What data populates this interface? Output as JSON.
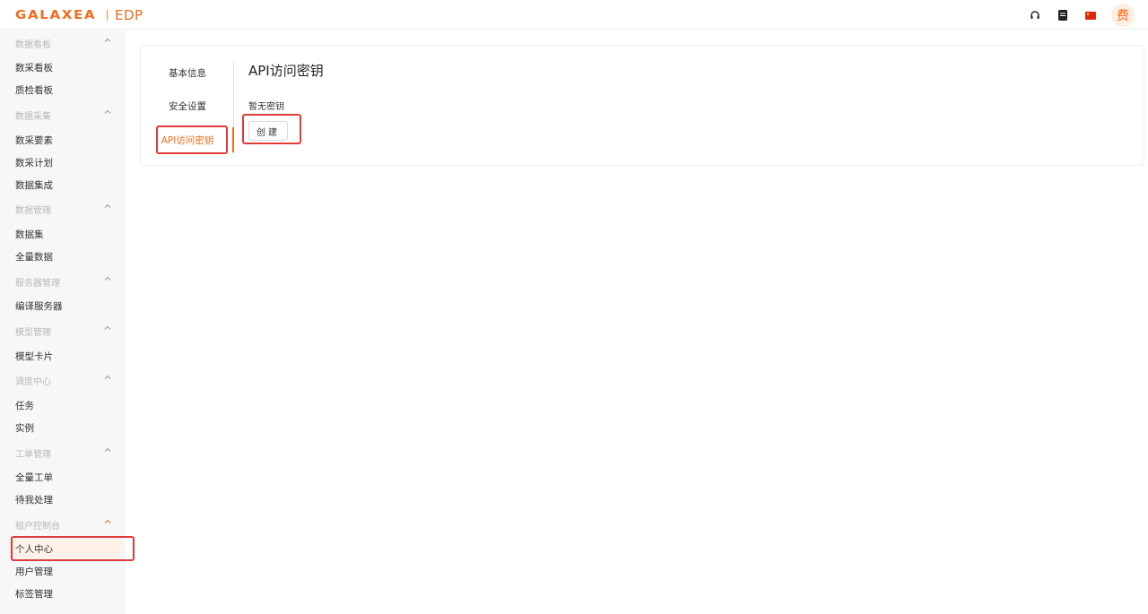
{
  "header": {
    "logo_brand": "GALAXEA",
    "logo_product": "EDP",
    "icons": [
      "headset-icon",
      "book-icon",
      "china-flag-icon"
    ],
    "avatar_text": "费"
  },
  "sidebar": {
    "groups": [
      {
        "label": "数据看板",
        "items": [
          "数采看板",
          "质检看板"
        ]
      },
      {
        "label": "数据采集",
        "items": [
          "数采要素",
          "数采计划",
          "数据集成"
        ]
      },
      {
        "label": "数据管理",
        "items": [
          "数据集",
          "全量数据"
        ]
      },
      {
        "label": "服务器管理",
        "items": [
          "编译服务器"
        ]
      },
      {
        "label": "模型管理",
        "items": [
          "模型卡片"
        ]
      },
      {
        "label": "调度中心",
        "items": [
          "任务",
          "实例"
        ]
      },
      {
        "label": "工单管理",
        "items": [
          "全量工单",
          "待我处理"
        ]
      },
      {
        "label": "租户控制台",
        "items": [
          "个人中心",
          "用户管理",
          "标签管理"
        ]
      }
    ],
    "active_item": "个人中心"
  },
  "main": {
    "tabs": [
      {
        "label": "基本信息"
      },
      {
        "label": "安全设置"
      },
      {
        "label": "API访问密钥"
      }
    ],
    "active_tab": "API访问密钥",
    "pane": {
      "title": "API访问密钥",
      "empty_text": "暂无密钥",
      "create_label": "创建"
    }
  },
  "colors": {
    "accent": "#f26a1b",
    "highlight": "#e03a3a",
    "sidebar_bg": "#f7f7f7"
  }
}
